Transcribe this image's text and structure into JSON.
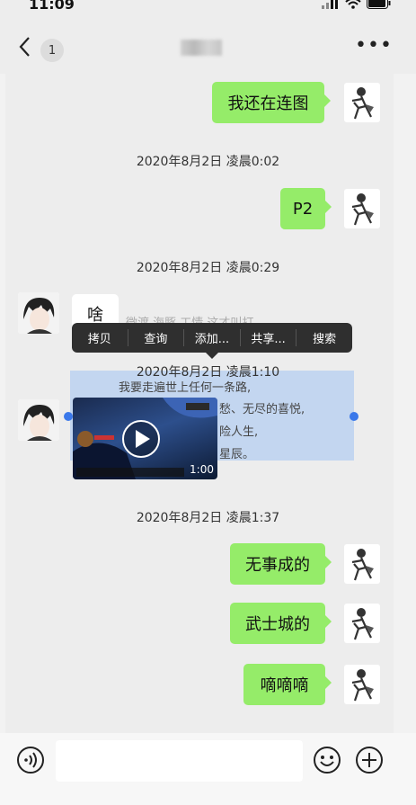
{
  "status": {
    "time": "11:09"
  },
  "header": {
    "unread_count": "1"
  },
  "timestamps": [
    "2020年8月2日 凌晨0:02",
    "2020年8月2日 凌晨0:29",
    "2020年8月2日 凌晨1:10",
    "2020年8月2日 凌晨1:37"
  ],
  "messages": {
    "m1": "我还在连图",
    "m2": "P2",
    "m3": "啥",
    "m5": "无事成的",
    "m6": "武士城的",
    "m7": "嘀嘀嘀"
  },
  "context_menu": [
    "拷贝",
    "查询",
    "添加...",
    "共享...",
    "搜索"
  ],
  "obscured_text": {
    "line1": "微渡 海豚 工情 这才叫打",
    "line2": "我要走遍世上任何一条路,",
    "line3": "愁、无尽的喜悦,",
    "line4": "险人生,",
    "line5": "星辰。"
  },
  "video": {
    "timer": "1:00"
  },
  "colors": {
    "my_bubble": "#95ec69",
    "menu_bg": "#2f2f2f",
    "selection_handle": "#3a78ea"
  }
}
